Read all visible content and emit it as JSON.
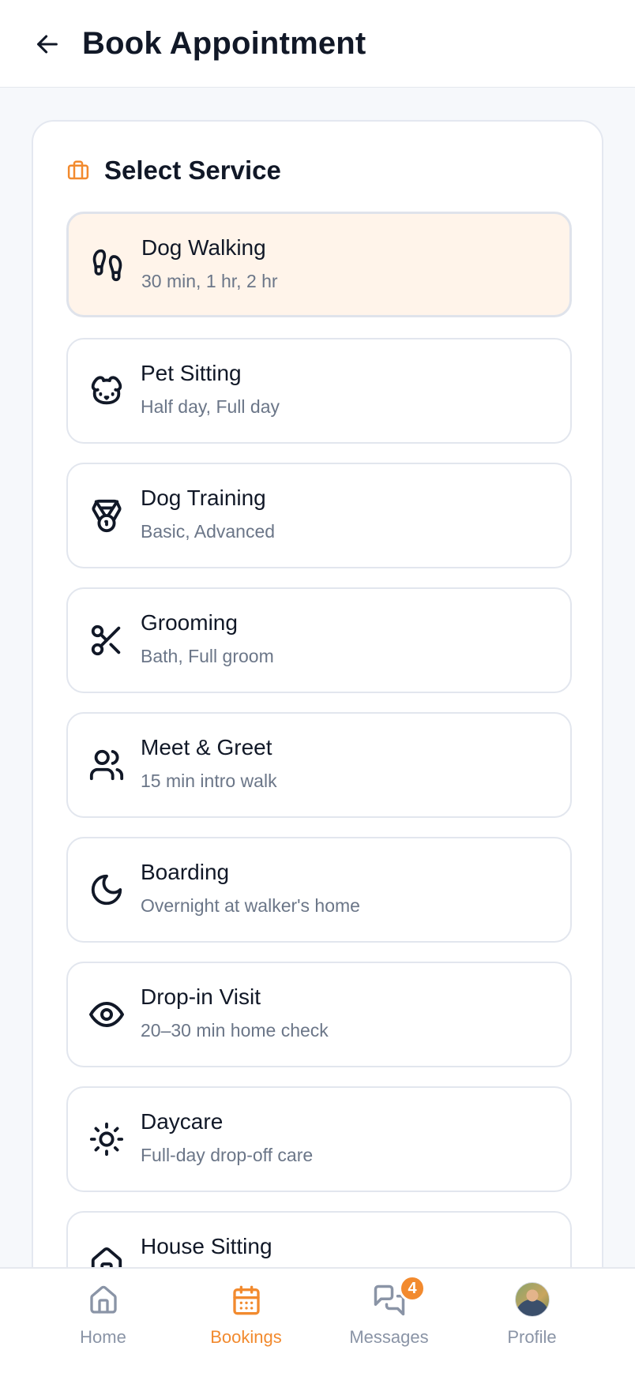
{
  "header": {
    "back_icon": "arrow-left-icon",
    "title": "Book Appointment"
  },
  "card": {
    "icon": "briefcase-icon",
    "title": "Select Service",
    "accent_color": "#f28a2e",
    "services": [
      {
        "name": "Dog Walking",
        "desc": "30 min, 1 hr, 2 hr",
        "icon": "footprints-icon",
        "selected": true
      },
      {
        "name": "Pet Sitting",
        "desc": "Half day, Full day",
        "icon": "dog-face-icon",
        "selected": false
      },
      {
        "name": "Dog Training",
        "desc": "Basic, Advanced",
        "icon": "medal-icon",
        "selected": false
      },
      {
        "name": "Grooming",
        "desc": "Bath, Full groom",
        "icon": "scissors-icon",
        "selected": false
      },
      {
        "name": "Meet & Greet",
        "desc": "15 min intro walk",
        "icon": "users-icon",
        "selected": false
      },
      {
        "name": "Boarding",
        "desc": "Overnight at walker's home",
        "icon": "moon-icon",
        "selected": false
      },
      {
        "name": "Drop-in Visit",
        "desc": "20–30 min home check",
        "icon": "eye-icon",
        "selected": false
      },
      {
        "name": "Daycare",
        "desc": "Full-day drop-off care",
        "icon": "sun-icon",
        "selected": false
      },
      {
        "name": "House Sitting",
        "desc": "",
        "icon": "house-icon",
        "selected": false
      }
    ]
  },
  "nav": {
    "items": [
      {
        "label": "Home",
        "icon": "home-icon",
        "active": false
      },
      {
        "label": "Bookings",
        "icon": "calendar-icon",
        "active": true
      },
      {
        "label": "Messages",
        "icon": "chat-icon",
        "active": false,
        "badge": "4"
      },
      {
        "label": "Profile",
        "icon": "avatar",
        "active": false
      }
    ]
  }
}
